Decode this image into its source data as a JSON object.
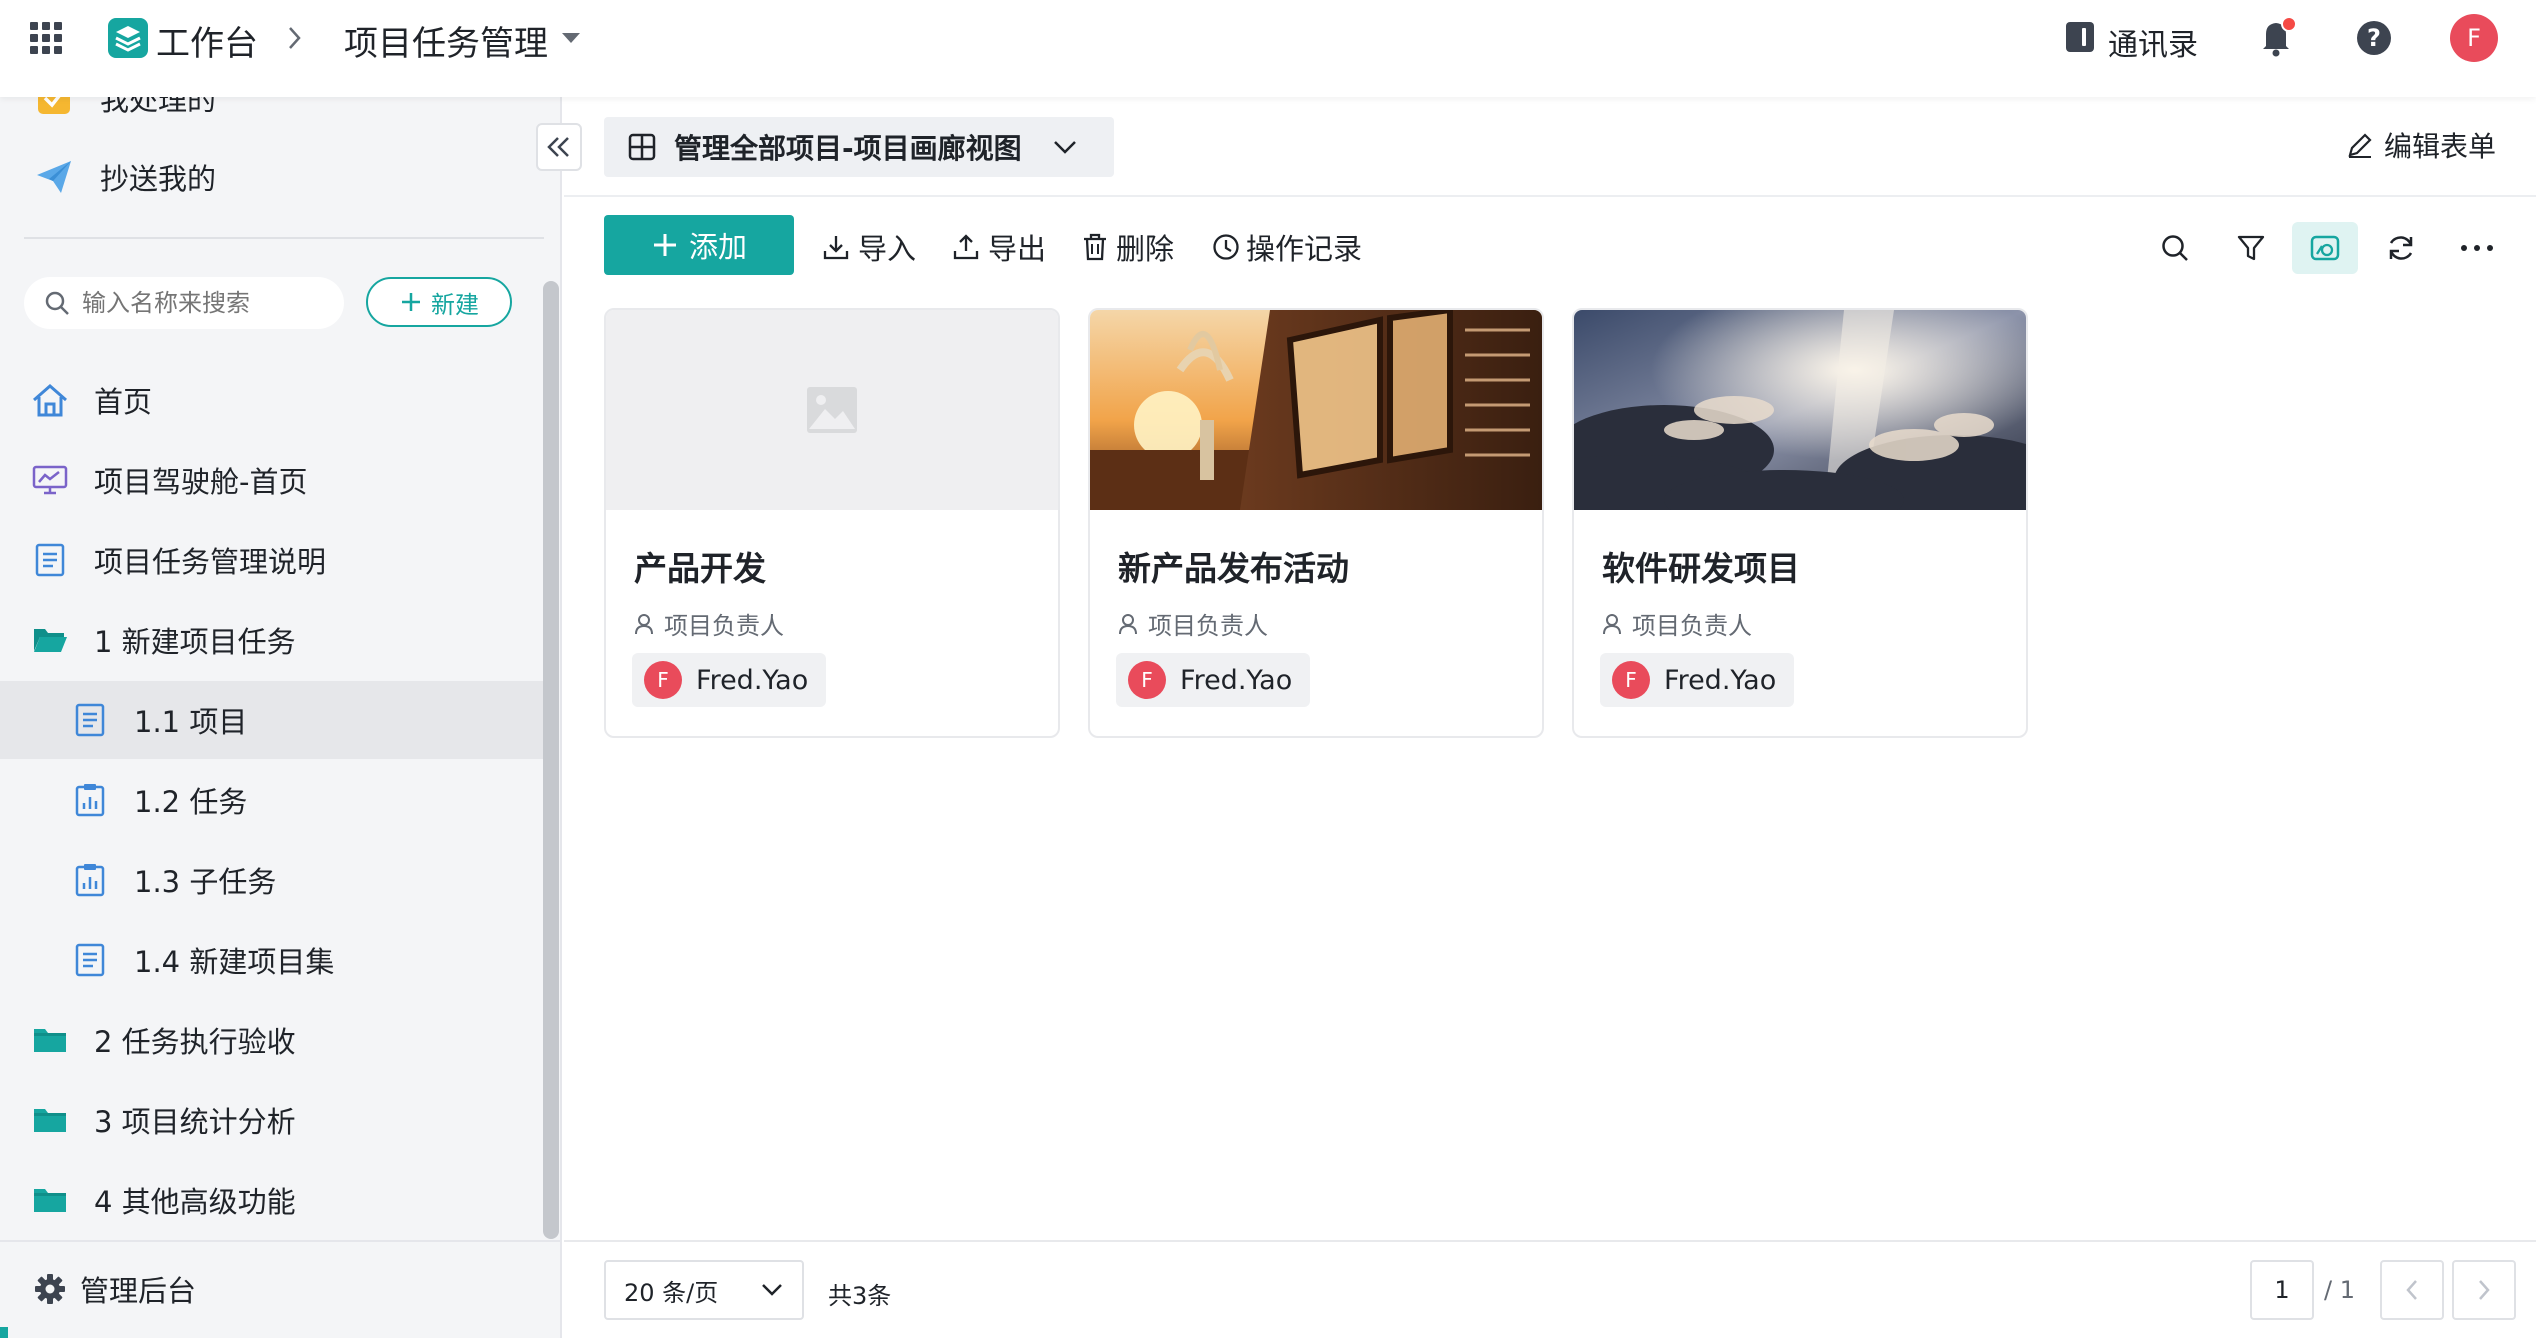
{
  "topbar": {
    "workspace": "工作台",
    "app_name": "项目任务管理",
    "contacts": "通讯录",
    "avatar_letter": "F",
    "accent": "#16a6a0",
    "notify_color": "#f54a45"
  },
  "sidebar": {
    "partial_item": "我处理的",
    "cc_item": "抄送我的",
    "search_placeholder": "输入名称来搜索",
    "new_button": "新建",
    "items": [
      {
        "label": "首页"
      },
      {
        "label": "项目驾驶舱-首页"
      },
      {
        "label": "项目任务管理说明"
      },
      {
        "label": "1 新建项目任务"
      },
      {
        "label": "1.1 项目"
      },
      {
        "label": "1.2 任务"
      },
      {
        "label": "1.3 子任务"
      },
      {
        "label": "1.4 新建项目集"
      },
      {
        "label": "2 任务执行验收"
      },
      {
        "label": "3 项目统计分析"
      },
      {
        "label": "4 其他高级功能"
      }
    ],
    "admin": "管理后台"
  },
  "content": {
    "view_name": "管理全部项目-项目画廊视图",
    "edit_form": "编辑表单",
    "toolbar": {
      "add": "添加",
      "import": "导入",
      "export": "导出",
      "delete": "删除",
      "history": "操作记录"
    },
    "cards": [
      {
        "title": "产品开发",
        "field_label": "项目负责人",
        "owner": "Fred.Yao",
        "avatar": "F"
      },
      {
        "title": "新产品发布活动",
        "field_label": "项目负责人",
        "owner": "Fred.Yao",
        "avatar": "F"
      },
      {
        "title": "软件研发项目",
        "field_label": "项目负责人",
        "owner": "Fred.Yao",
        "avatar": "F"
      }
    ],
    "footer": {
      "page_size": "20 条/页",
      "total": "共3条",
      "current_page": "1",
      "total_pages": "/ 1"
    }
  }
}
